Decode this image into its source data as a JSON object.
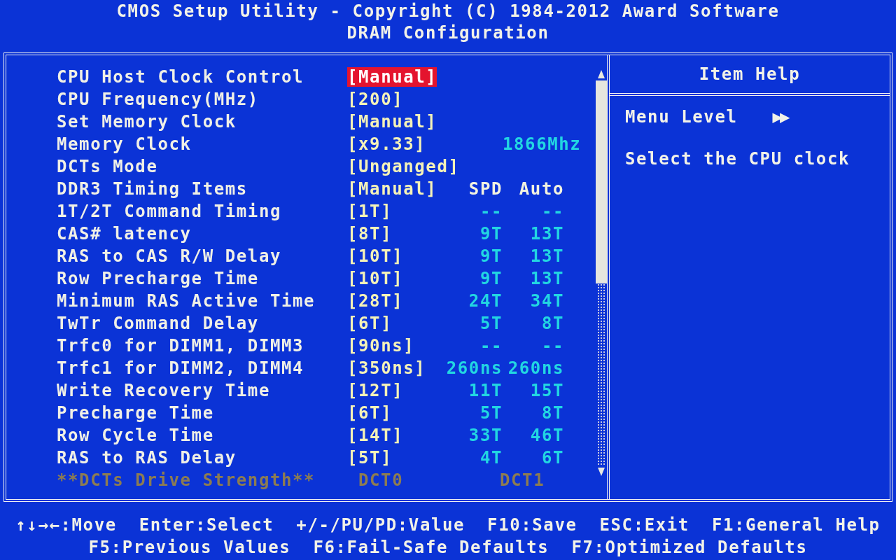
{
  "header": {
    "title": "CMOS Setup Utility - Copyright (C) 1984-2012 Award Software",
    "subtitle": "DRAM Configuration"
  },
  "settings": [
    {
      "kind": "setting",
      "label": "CPU Host Clock Control",
      "value": "[Manual]",
      "selected": true
    },
    {
      "kind": "setting",
      "label": "CPU Frequency(MHz)",
      "value": "[200]",
      "selected": false
    },
    {
      "kind": "setting",
      "label": "Set Memory Clock",
      "value": "[Manual]",
      "selected": false
    },
    {
      "kind": "setting",
      "label": "Memory Clock",
      "value": "[x9.33]",
      "auto": "1866Mhz",
      "selected": false
    },
    {
      "kind": "setting",
      "label": "DCTs Mode",
      "value": "[Unganged]",
      "selected": false
    },
    {
      "kind": "columns",
      "label": "DDR3 Timing Items",
      "value": "[Manual]",
      "spd": "SPD",
      "auto": "Auto",
      "selected": false
    },
    {
      "kind": "setting",
      "label": "1T/2T Command Timing",
      "value": "[1T]",
      "spd": "--",
      "auto": "--",
      "selected": false
    },
    {
      "kind": "setting",
      "label": "CAS# latency",
      "value": "[8T]",
      "spd": "9T",
      "auto": "13T",
      "selected": false
    },
    {
      "kind": "setting",
      "label": "RAS to CAS R/W Delay",
      "value": "[10T]",
      "spd": "9T",
      "auto": "13T",
      "selected": false
    },
    {
      "kind": "setting",
      "label": "Row Precharge Time",
      "value": "[10T]",
      "spd": "9T",
      "auto": "13T",
      "selected": false
    },
    {
      "kind": "setting",
      "label": "Minimum RAS Active Time",
      "value": "[28T]",
      "spd": "24T",
      "auto": "34T",
      "selected": false
    },
    {
      "kind": "setting",
      "label": "TwTr Command Delay",
      "value": "[6T]",
      "spd": "5T",
      "auto": "8T",
      "selected": false
    },
    {
      "kind": "setting",
      "label": "Trfc0 for DIMM1, DIMM3",
      "value": "[90ns]",
      "spd": "--",
      "auto": "--",
      "selected": false
    },
    {
      "kind": "setting",
      "label": "Trfc1 for DIMM2, DIMM4",
      "value": "[350ns]",
      "spd": "260ns",
      "auto": "260ns",
      "selected": false
    },
    {
      "kind": "setting",
      "label": "Write Recovery Time",
      "value": "[12T]",
      "spd": "11T",
      "auto": "15T",
      "selected": false
    },
    {
      "kind": "setting",
      "label": "Precharge Time",
      "value": "[6T]",
      "spd": "5T",
      "auto": "8T",
      "selected": false
    },
    {
      "kind": "setting",
      "label": "Row Cycle Time",
      "value": "[14T]",
      "spd": "33T",
      "auto": "46T",
      "selected": false
    },
    {
      "kind": "setting",
      "label": "RAS to RAS Delay",
      "value": "[5T]",
      "spd": "4T",
      "auto": "6T",
      "selected": false
    },
    {
      "kind": "heading",
      "label": "**DCTs Drive Strength**",
      "spd": "DCT0",
      "auto": "DCT1"
    }
  ],
  "item_help": {
    "title": "Item Help",
    "menu_level": "Menu Level",
    "menu_level_arrows": "▶▶",
    "text": "Select the CPU clock"
  },
  "footer": [
    [
      "↑↓→←:Move",
      "Enter:Select",
      "+/-/PU/PD:Value",
      "F10:Save",
      "ESC:Exit",
      "F1:General Help"
    ],
    [
      "F5:Previous Values",
      "F6:Fail-Safe Defaults",
      "F7:Optimized Defaults"
    ]
  ]
}
